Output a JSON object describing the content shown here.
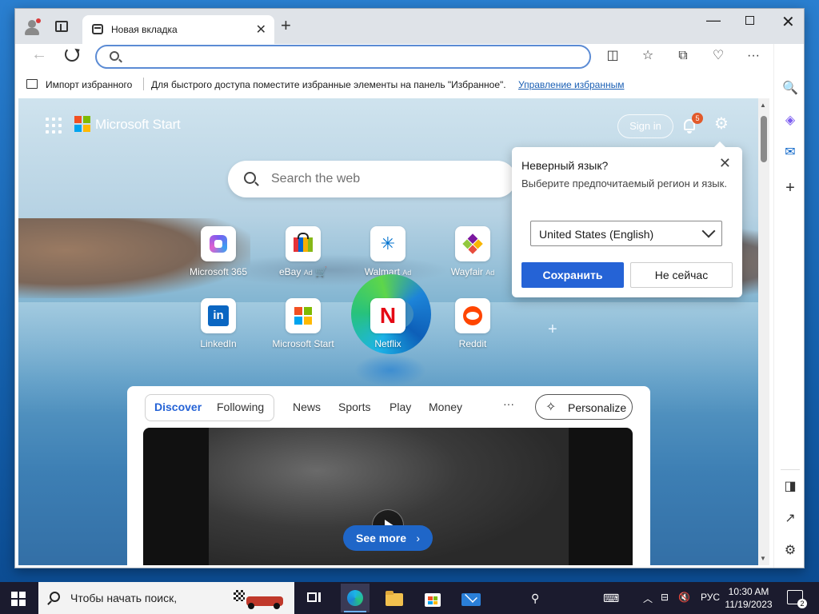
{
  "browser": {
    "tab_title": "Новая вкладка",
    "address_value": "",
    "favorites_bar": {
      "import_label": "Импорт избранного",
      "message": "Для быстрого доступа поместите избранные элементы на панель \"Избранное\".",
      "manage_link": "Управление избранным"
    }
  },
  "start_page": {
    "brand": "Microsoft Start",
    "sign_in": "Sign in",
    "notification_count": "5",
    "search_placeholder": "Search the web",
    "tiles": [
      {
        "label": "Microsoft 365",
        "ad": "",
        "icon": "microsoft-365-icon"
      },
      {
        "label": "eBay",
        "ad": "Ad",
        "icon": "ebay-icon"
      },
      {
        "label": "Walmart",
        "ad": "Ad",
        "icon": "walmart-icon"
      },
      {
        "label": "Wayfair",
        "ad": "Ad",
        "icon": "wayfair-icon"
      },
      {
        "label": "LinkedIn",
        "ad": "",
        "icon": "linkedin-icon"
      },
      {
        "label": "Microsoft Start",
        "ad": "",
        "icon": "microsoft-start-icon"
      },
      {
        "label": "Netflix",
        "ad": "",
        "icon": "netflix-icon"
      },
      {
        "label": "Reddit",
        "ad": "",
        "icon": "reddit-icon"
      }
    ],
    "feed": {
      "tabs": [
        "Discover",
        "Following"
      ],
      "active_tab": "Discover",
      "nav": [
        "News",
        "Sports",
        "Play",
        "Money"
      ],
      "more": "···",
      "personalize": "Personalize",
      "see_more": "See more"
    }
  },
  "language_popup": {
    "title": "Неверный язык?",
    "text": "Выберите предпочитаемый регион и язык.",
    "selected_region": "United States (English)",
    "save": "Сохранить",
    "not_now": "Не сейчас"
  },
  "taskbar": {
    "search_placeholder": "Чтобы начать поиск,",
    "language": "РУС",
    "time": "10:30 AM",
    "date": "11/19/2023",
    "notification_count": "2"
  },
  "colors": {
    "accent": "#2563d6",
    "badge": "#e25a2b"
  }
}
